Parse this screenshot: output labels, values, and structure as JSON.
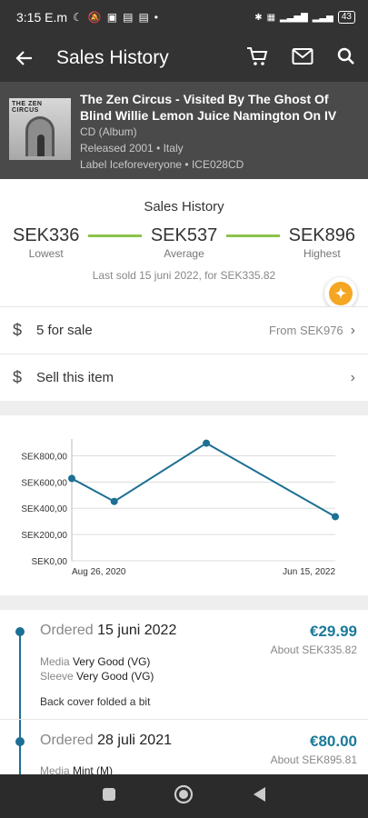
{
  "status_bar": {
    "time": "3:15 E.m",
    "battery": "43"
  },
  "app_bar": {
    "title": "Sales History"
  },
  "release": {
    "title": "The Zen Circus - Visited By The Ghost Of Blind Willie Lemon Juice Namington On IV",
    "format": "CD (Album)",
    "released": "Released 2001 • Italy",
    "label": "Label Iceforeveryone • ICE028CD",
    "cover_text": "THE ZEN CIRCUS"
  },
  "summary": {
    "title": "Sales History",
    "lowest_value": "SEK336",
    "lowest_label": "Lowest",
    "average_value": "SEK537",
    "average_label": "Average",
    "highest_value": "SEK896",
    "highest_label": "Highest",
    "last_sold": "Last sold 15 juni 2022, for SEK335.82"
  },
  "for_sale": {
    "label": "5 for sale",
    "from": "From SEK976"
  },
  "sell": {
    "label": "Sell this item"
  },
  "chart_data": {
    "type": "line",
    "x": [
      "2020-08-26",
      "2020-12-10",
      "2021-07-28",
      "2022-06-15"
    ],
    "values": [
      627,
      452,
      896,
      336
    ],
    "x_tick_labels": [
      "Aug 26, 2020",
      "Jun 15, 2022"
    ],
    "y_tick_labels": [
      "SEK800,00",
      "SEK600,00",
      "SEK400,00",
      "SEK200,00",
      "SEK0,00"
    ],
    "ylim": [
      0,
      900
    ],
    "grid": true,
    "color": "#1d6f94"
  },
  "history": [
    {
      "ordered_label": "Ordered",
      "date": "15 juni 2022",
      "price": "€29.99",
      "about": "About SEK335.82",
      "media_label": "Media",
      "media": "Very Good (VG)",
      "sleeve_label": "Sleeve",
      "sleeve": "Very Good (VG)",
      "note": "Back cover folded a bit"
    },
    {
      "ordered_label": "Ordered",
      "date": "28 juli 2021",
      "price": "€80.00",
      "about": "About SEK895.81",
      "media_label": "Media",
      "media": "Mint (M)"
    }
  ]
}
